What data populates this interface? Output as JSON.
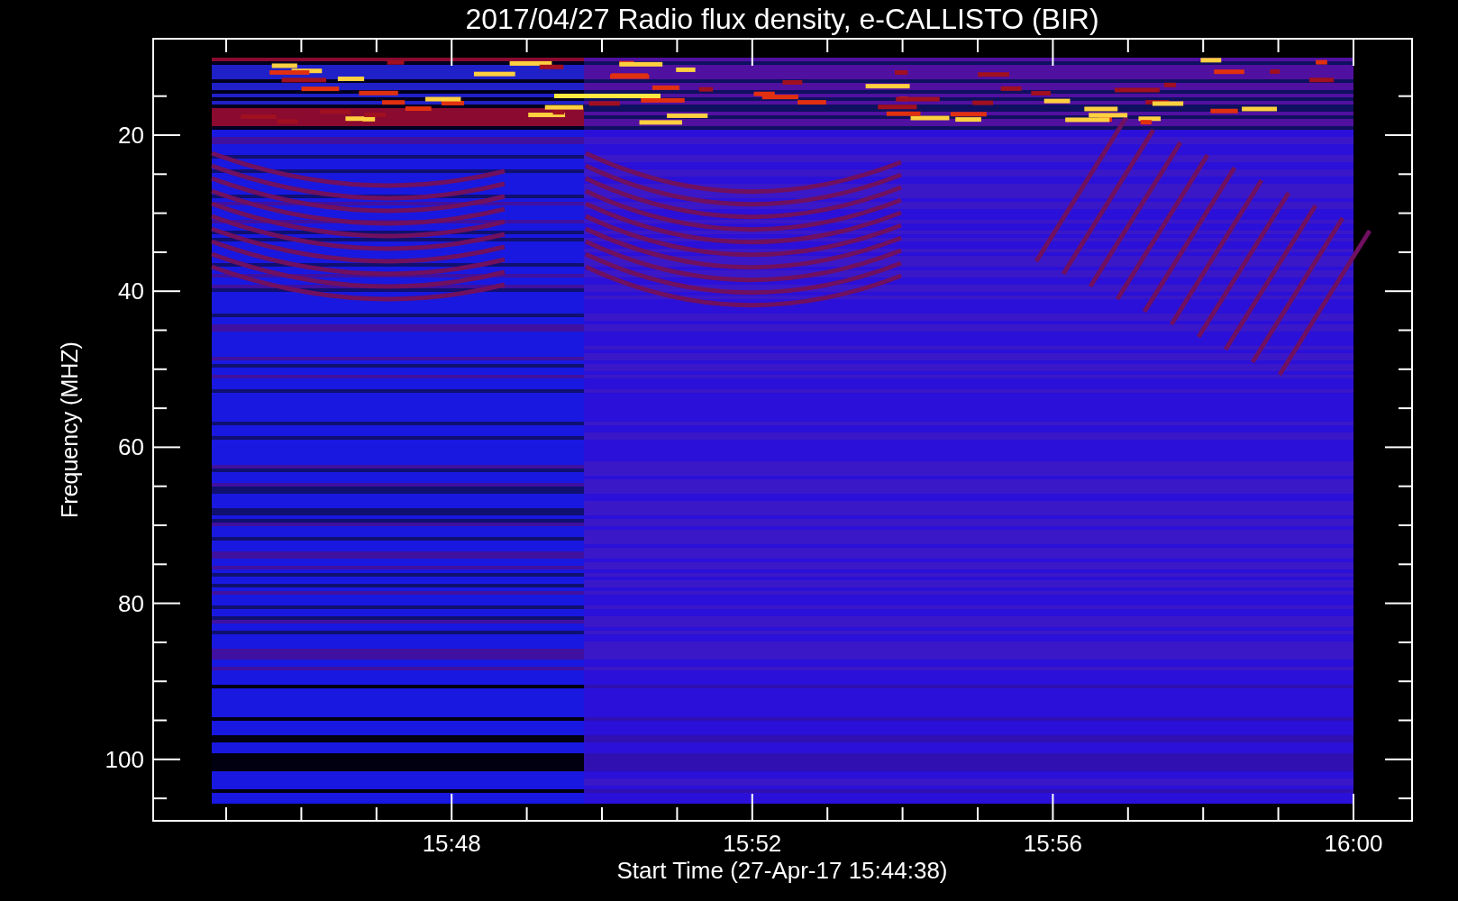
{
  "title": "2017/04/27  Radio flux density, e-CALLISTO (BIR)",
  "ylabel": "Frequency (MHZ)",
  "xlabel": "Start Time (27-Apr-17 15:44:38)",
  "yticks": [
    "20",
    "40",
    "60",
    "80",
    "100"
  ],
  "xticks": [
    "15:48",
    "15:52",
    "15:56",
    "16:00"
  ]
}
